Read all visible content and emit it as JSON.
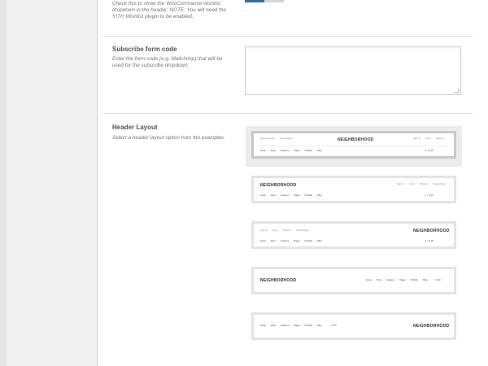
{
  "wishlist": {
    "desc": "Check this to show the WooCommerce wishlist dropdown in the header. NOTE: You will need the YITH Wishlist plugin to be enabled.."
  },
  "subscribe": {
    "title": "Subscribe form code",
    "desc": "Enter the form code (e.g. Mailchimp) that will be used for the subscribe dropdown.",
    "value": ""
  },
  "header_layout": {
    "title": "Header Layout",
    "desc": "Select a header layout option from the examples.",
    "selected_index": 0,
    "logo": "NEIGHBORHOOD",
    "nav": [
      "Home",
      "Shop",
      "Features",
      "Pages",
      "Portfolio",
      "Blog"
    ],
    "top_left_a": [
      "Welcome Guest",
      "Privacy Pages"
    ],
    "top_right_a": [
      "Sign Up",
      "Log In",
      "Welcome"
    ],
    "top_right_b": [
      "Sign Up",
      "Log In",
      "Welcome",
      "Choose Page"
    ],
    "cart_icons": [
      "search-icon",
      "bag-icon",
      "heart-icon"
    ],
    "cart_text": "0",
    "wish_text": "0"
  }
}
